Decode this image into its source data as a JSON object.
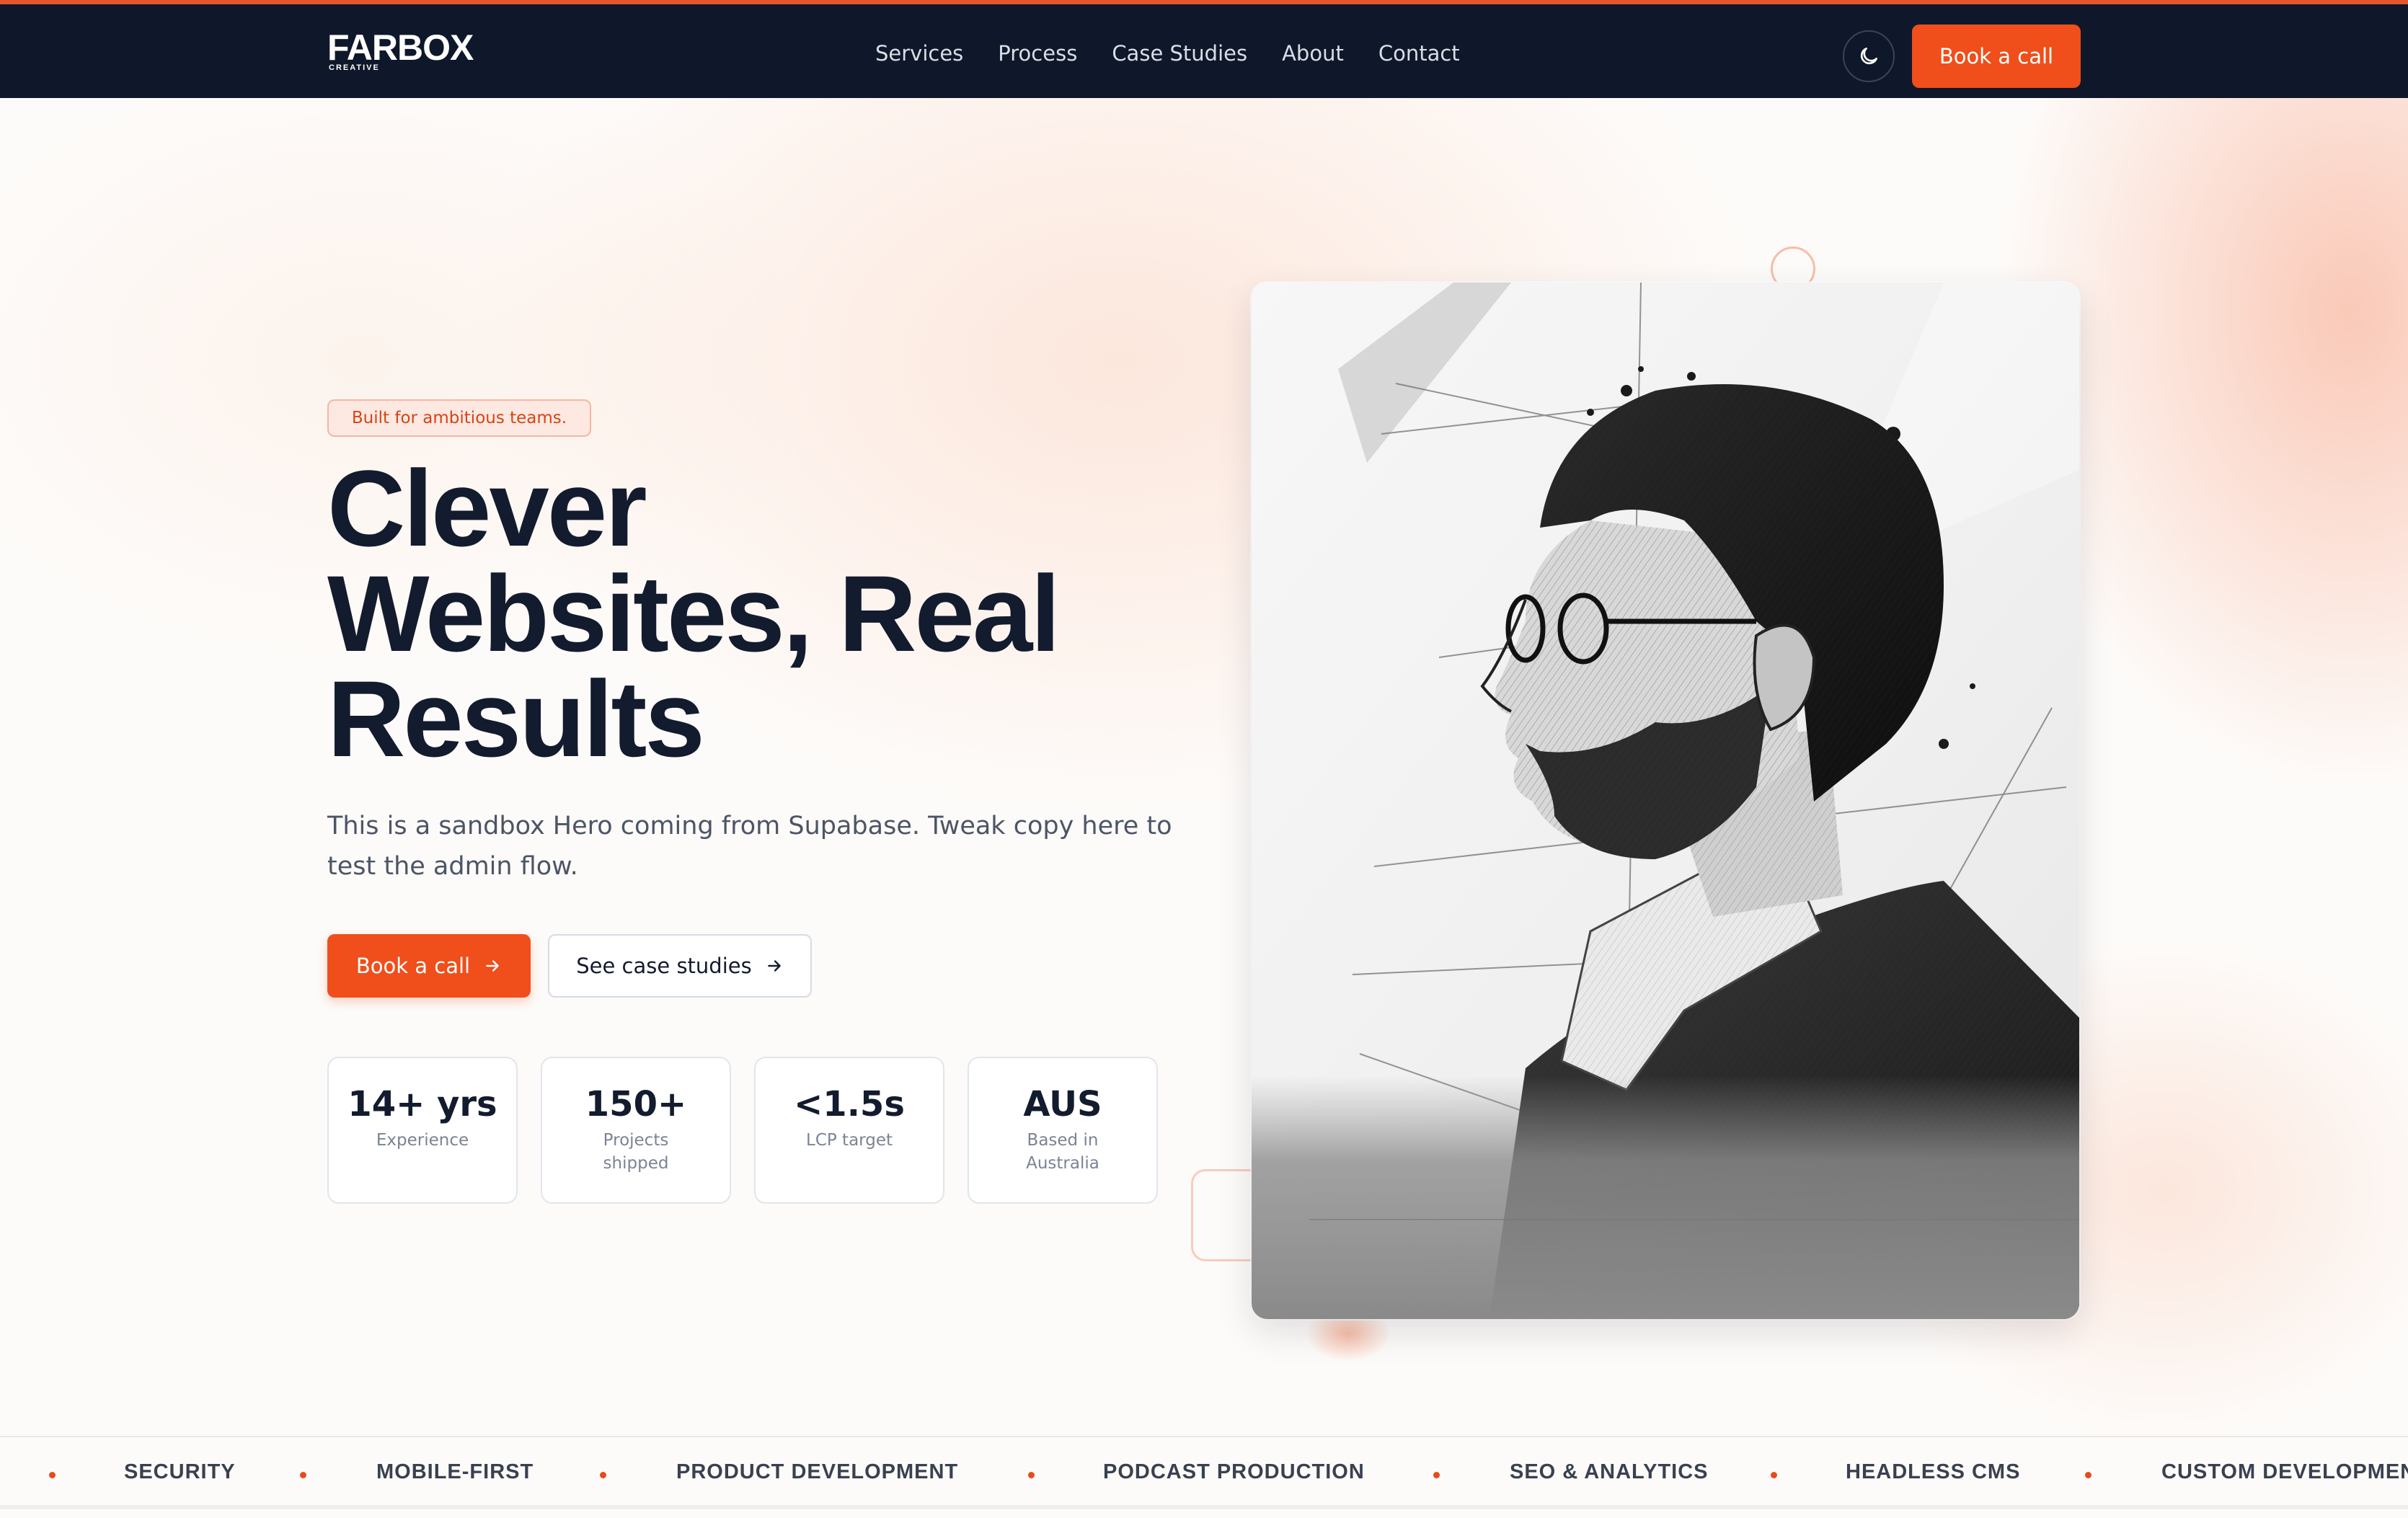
{
  "nav": {
    "logo_main": "FARBOX",
    "logo_sub": "CREATIVE",
    "links": [
      "Services",
      "Process",
      "Case Studies",
      "About",
      "Contact"
    ],
    "theme_icon": "moon-icon",
    "cta_label": "Book a call"
  },
  "hero": {
    "badge": "Built for ambitious teams.",
    "headline_line1": "Clever",
    "headline_line2": "Websites, Real",
    "headline_line3": "Results",
    "subcopy": "This is a sandbox Hero coming from Supabase. Tweak copy here to test the admin flow.",
    "primary_button": "Book a call",
    "secondary_button": "See case studies",
    "button_icon": "arrow-right-icon",
    "stats": [
      {
        "value": "14+ yrs",
        "label": "Experience"
      },
      {
        "value": "150+",
        "label": "Projects shipped"
      },
      {
        "value": "<1.5s",
        "label": "LCP target"
      },
      {
        "value": "AUS",
        "label": "Based in Australia"
      }
    ]
  },
  "marquee": {
    "items": [
      "SECURITY",
      "MOBILE-FIRST",
      "PRODUCT DEVELOPMENT",
      "PODCAST PRODUCTION",
      "SEO & ANALYTICS",
      "HEADLESS CMS",
      "CUSTOM DEVELOPMEN"
    ]
  },
  "colors": {
    "accent": "#f04e1a",
    "nav_bg": "#0f182a",
    "text_dark": "#131b2e"
  }
}
